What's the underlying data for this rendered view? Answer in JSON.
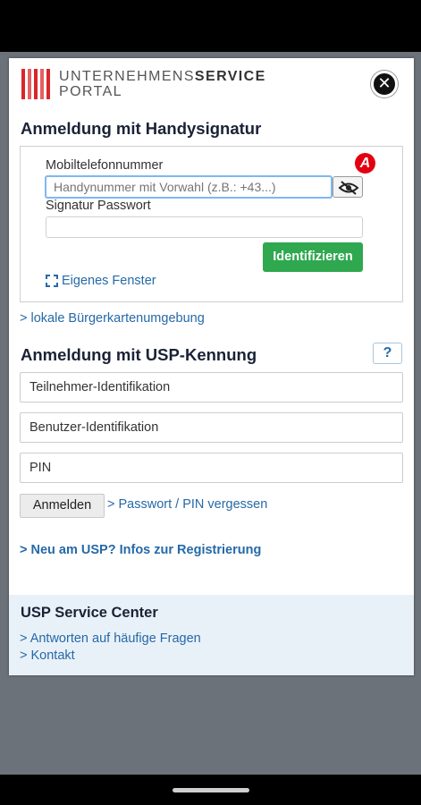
{
  "logo": {
    "line1_light": "UNTERNEHMENS",
    "line1_bold": "SERVICE",
    "line2": "PORTAL"
  },
  "close_symbol": "✕",
  "handysignatur": {
    "title": "Anmeldung mit Handysignatur",
    "a_logo_letter": "A",
    "mobile_label": "Mobiltelefonnummer",
    "mobile_placeholder": "Handynummer mit Vorwahl (z.B.: +43...)",
    "password_label": "Signatur Passwort",
    "identify_button": "Identifizieren",
    "own_window_link": "Eigenes Fenster"
  },
  "local_link": "> lokale Bürgerkartenumgebung",
  "usp": {
    "title": "Anmeldung mit USP-Kennung",
    "help_button": "?",
    "participant_placeholder": "Teilnehmer-Identifikation",
    "user_placeholder": "Benutzer-Identifikation",
    "pin_placeholder": "PIN",
    "login_button": "Anmelden",
    "forgot_link": "> Passwort / PIN vergessen",
    "register_link": ">  Neu am USP? Infos zur Registrierung"
  },
  "service_center": {
    "title": "USP Service Center",
    "faq_link": "> Antworten auf häufige Fragen",
    "contact_link": "> Kontakt"
  },
  "colors": {
    "accent_green": "#2fa84f",
    "link_blue": "#2569a8",
    "brand_red": "#d9262b",
    "service_bg": "#e9f1f8"
  }
}
